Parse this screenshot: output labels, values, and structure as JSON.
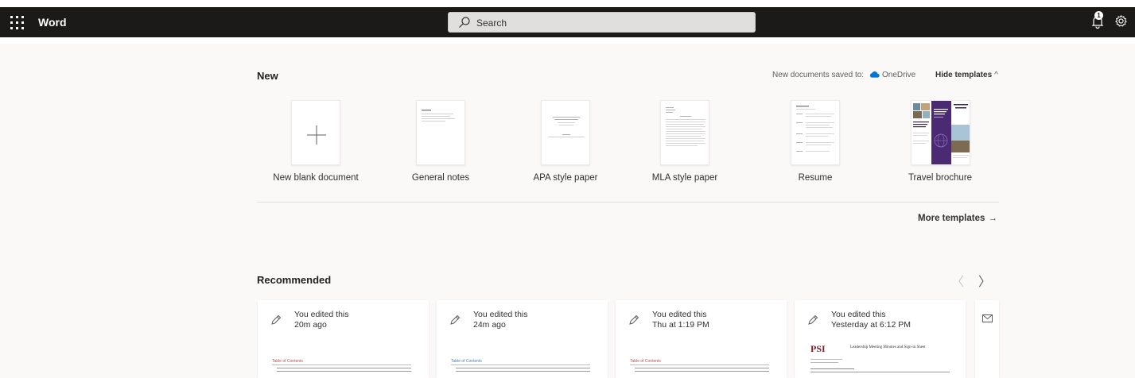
{
  "app": {
    "name": "Word"
  },
  "search": {
    "placeholder": "Search"
  },
  "notifications": {
    "count": "1"
  },
  "new_section": {
    "title": "New",
    "saved_to_label": "New documents saved to:",
    "saved_to_location": "OneDrive",
    "hide_templates_label": "Hide templates",
    "templates": [
      {
        "label": "New blank document"
      },
      {
        "label": "General notes"
      },
      {
        "label": "APA style paper"
      },
      {
        "label": "MLA style paper"
      },
      {
        "label": "Resume"
      },
      {
        "label": "Travel brochure"
      }
    ],
    "more_templates_label": "More templates",
    "more_arrow": "→",
    "hide_chevron": "^"
  },
  "recommended": {
    "title": "Recommended",
    "prev": "〈",
    "next": "〉",
    "cards": [
      {
        "line1": "You edited this",
        "line2": "20m ago",
        "preview_title": "Table of Contents"
      },
      {
        "line1": "You edited this",
        "line2": "24m ago",
        "preview_title": "Table of Contents"
      },
      {
        "line1": "You edited this",
        "line2": "Thu at 1:19 PM",
        "preview_title": "Table of Contents"
      },
      {
        "line1": "You edited this",
        "line2": "Yesterday at 6:12 PM",
        "preview_title": "Leadership Meeting Minutes and Sign-in Sheet",
        "logo": "PSI"
      }
    ]
  },
  "colors": {
    "topbar": "#1b1a19",
    "accent": "#0078d4"
  }
}
